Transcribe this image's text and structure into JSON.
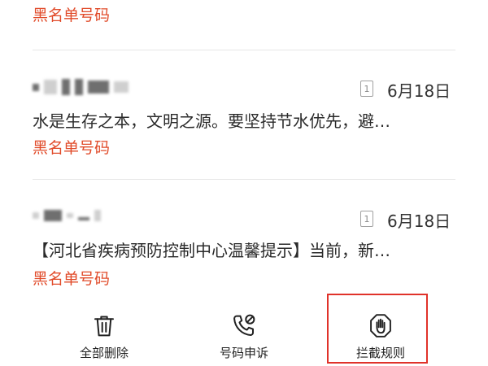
{
  "messages": [
    {
      "tag": "黑名单号码"
    },
    {
      "sim_slot": "1",
      "date": "6月18日",
      "preview": "水是生存之本，文明之源。要坚持节水优先，避…",
      "tag": "黑名单号码"
    },
    {
      "sim_slot": "1",
      "date": "6月18日",
      "preview": "【河北省疾病预防控制中心温馨提示】当前，新…",
      "tag": "黑名单号码"
    }
  ],
  "actions": {
    "delete_all": {
      "label": "全部删除",
      "icon": "trash-icon"
    },
    "number_appeal": {
      "label": "号码申诉",
      "icon": "phone-appeal-icon"
    },
    "block_rules": {
      "label": "拦截规则",
      "icon": "hand-stop-icon"
    }
  },
  "colors": {
    "tag_red": "#e14b2a",
    "highlight_red": "#e0322a",
    "divider": "#e6e6e6"
  }
}
